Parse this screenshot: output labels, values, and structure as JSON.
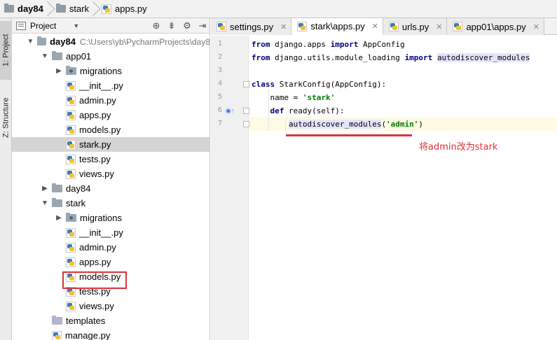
{
  "breadcrumb": {
    "items": [
      {
        "label": "day84",
        "icon": "folder-icon",
        "bold": true
      },
      {
        "label": "stark",
        "icon": "folder-icon",
        "bold": false
      },
      {
        "label": "apps.py",
        "icon": "python-file-icon",
        "bold": false
      }
    ]
  },
  "tool_strip": {
    "project_tab": "1: Project",
    "structure_tab": "Z: Structure"
  },
  "project_panel": {
    "title": "Project",
    "tree": [
      {
        "label": "day84",
        "path": "C:\\Users\\yb\\PycharmProjects\\day8",
        "type": "folder",
        "expanded": true,
        "depth": 0,
        "bold": true
      },
      {
        "label": "app01",
        "type": "folder",
        "expanded": true,
        "depth": 1
      },
      {
        "label": "migrations",
        "type": "package",
        "expanded": false,
        "depth": 2
      },
      {
        "label": "__init__.py",
        "type": "py",
        "depth": 2
      },
      {
        "label": "admin.py",
        "type": "py",
        "depth": 2
      },
      {
        "label": "apps.py",
        "type": "py",
        "depth": 2
      },
      {
        "label": "models.py",
        "type": "py",
        "depth": 2
      },
      {
        "label": "stark.py",
        "type": "py",
        "depth": 2,
        "selected": true
      },
      {
        "label": "tests.py",
        "type": "py",
        "depth": 2
      },
      {
        "label": "views.py",
        "type": "py",
        "depth": 2
      },
      {
        "label": "day84",
        "type": "folder",
        "expanded": false,
        "depth": 1
      },
      {
        "label": "stark",
        "type": "folder",
        "expanded": true,
        "depth": 1
      },
      {
        "label": "migrations",
        "type": "package",
        "expanded": false,
        "depth": 2
      },
      {
        "label": "__init__.py",
        "type": "py",
        "depth": 2
      },
      {
        "label": "admin.py",
        "type": "py",
        "depth": 2
      },
      {
        "label": "apps.py",
        "type": "py",
        "depth": 2,
        "boxed": true
      },
      {
        "label": "models.py",
        "type": "py",
        "depth": 2
      },
      {
        "label": "tests.py",
        "type": "py",
        "depth": 2
      },
      {
        "label": "views.py",
        "type": "py",
        "depth": 2
      },
      {
        "label": "templates",
        "type": "templates",
        "depth": 1
      },
      {
        "label": "manage.py",
        "type": "py",
        "depth": 1
      }
    ]
  },
  "editor_tabs": [
    {
      "label": "settings.py",
      "active": false
    },
    {
      "label": "stark\\apps.py",
      "active": true
    },
    {
      "label": "urls.py",
      "active": false
    },
    {
      "label": "app01\\apps.py",
      "active": false
    }
  ],
  "editor": {
    "lines": [
      {
        "n": "1",
        "tokens": [
          {
            "t": "from",
            "c": "kw"
          },
          {
            "t": " django.apps ",
            "c": ""
          },
          {
            "t": "import",
            "c": "kw"
          },
          {
            "t": " AppConfig",
            "c": ""
          }
        ]
      },
      {
        "n": "2",
        "tokens": [
          {
            "t": "from",
            "c": "kw"
          },
          {
            "t": " django.utils.module_loading ",
            "c": ""
          },
          {
            "t": "import",
            "c": "kw"
          },
          {
            "t": " ",
            "c": ""
          },
          {
            "t": "autodiscover_modules",
            "c": "hl-name"
          }
        ]
      },
      {
        "n": "3",
        "tokens": []
      },
      {
        "n": "4",
        "tokens": [
          {
            "t": "class",
            "c": "kw"
          },
          {
            "t": " StarkConfig(AppConfig):",
            "c": ""
          }
        ]
      },
      {
        "n": "5",
        "tokens": [
          {
            "t": "    name = ",
            "c": ""
          },
          {
            "t": "'stark'",
            "c": "str"
          }
        ]
      },
      {
        "n": "6",
        "tokens": [
          {
            "t": "    ",
            "c": ""
          },
          {
            "t": "def",
            "c": "kw"
          },
          {
            "t": " ready(self):",
            "c": ""
          }
        ]
      },
      {
        "n": "7",
        "tokens": [
          {
            "t": "        ",
            "c": ""
          },
          {
            "t": "autodiscover_modules",
            "c": "hl-name"
          },
          {
            "t": "(",
            "c": ""
          },
          {
            "t": "'admin'",
            "c": "str"
          },
          {
            "t": ")",
            "c": ""
          }
        ]
      }
    ],
    "annotation": "将admin改为stark"
  }
}
